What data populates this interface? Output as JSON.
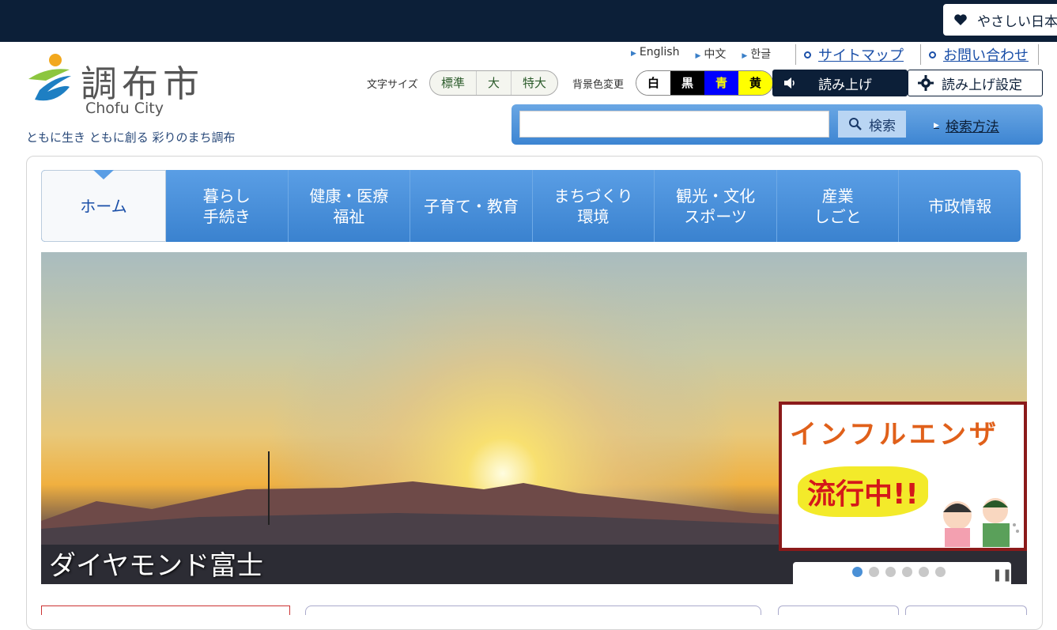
{
  "topbar": {
    "easy_japanese": "やさしい日本語"
  },
  "header": {
    "logo_text": "調布市",
    "logo_en": "Chofu City",
    "tagline": "ともに生き ともに創る 彩りのまち調布",
    "languages": [
      "English",
      "中文",
      "한글"
    ],
    "sitemap": "サイトマップ",
    "contact": "お問い合わせ",
    "font_size_label": "文字サイズ",
    "font_sizes": [
      "標準",
      "大",
      "特大"
    ],
    "bg_color_label": "背景色変更",
    "bg_colors": [
      {
        "label": "白",
        "bg": "#ffffff",
        "fg": "#000000"
      },
      {
        "label": "黒",
        "bg": "#000000",
        "fg": "#ffffff"
      },
      {
        "label": "青",
        "bg": "#0000ff",
        "fg": "#ffff00"
      },
      {
        "label": "黄",
        "bg": "#ffff00",
        "fg": "#000000"
      }
    ],
    "read_aloud": "読み上げ",
    "read_settings": "読み上げ設定",
    "search_button": "検索",
    "search_how": "検索方法"
  },
  "nav": {
    "items": [
      "ホーム",
      "暮らし\n手続き",
      "健康・医療\n福祉",
      "子育て・教育",
      "まちづくり\n環境",
      "観光・文化\nスポーツ",
      "産業\nしごと",
      "市政情報"
    ]
  },
  "hero": {
    "caption": "ダイヤモンド富士",
    "banner_title": "インフルエンザ",
    "banner_sub": "流行中!!",
    "slides": 6,
    "active_slide": 1
  },
  "colors": {
    "brand_dark": "#0c1f38",
    "nav_blue": "#3a82cf"
  }
}
